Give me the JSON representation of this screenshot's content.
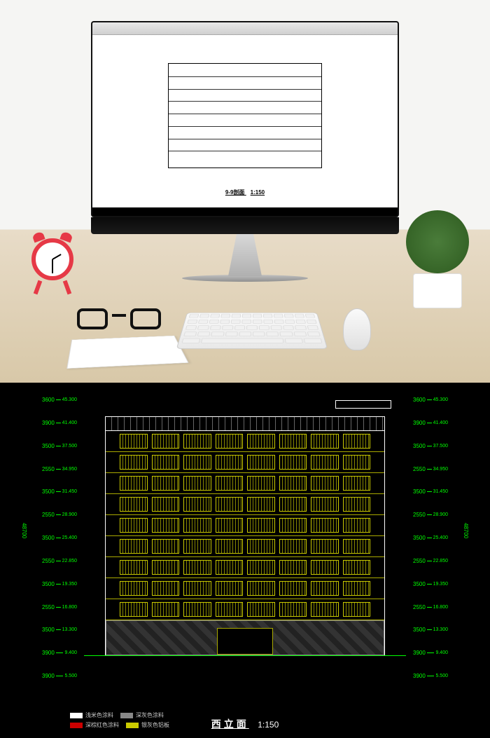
{
  "top_drawing": {
    "title": "9-9剖面",
    "scale": "1:150"
  },
  "elevation": {
    "title": "西立面",
    "scale": "1:150",
    "total_height": "48700",
    "floors": [
      {
        "height": "3600",
        "elevation": "45.300"
      },
      {
        "height": "3900",
        "elevation": "41.400"
      },
      {
        "height": "3500",
        "elevation": "37.500"
      },
      {
        "height": "2550",
        "elevation": "34.950"
      },
      {
        "height": "3500",
        "elevation": "31.450"
      },
      {
        "height": "2550",
        "elevation": "28.900"
      },
      {
        "height": "3500",
        "elevation": "25.400"
      },
      {
        "height": "2550",
        "elevation": "22.850"
      },
      {
        "height": "3500",
        "elevation": "19.350"
      },
      {
        "height": "2550",
        "elevation": "16.800"
      },
      {
        "height": "3500",
        "elevation": "13.300"
      },
      {
        "height": "3900",
        "elevation": "9.400"
      },
      {
        "height": "3900",
        "elevation": "5.500"
      }
    ],
    "right_floors": [
      {
        "height": "3600",
        "elevation": "45.300"
      },
      {
        "height": "3900",
        "elevation": "41.400"
      },
      {
        "height": "3500",
        "elevation": "37.500"
      },
      {
        "height": "2550",
        "elevation": "34.950"
      },
      {
        "height": "3500",
        "elevation": "31.450"
      },
      {
        "height": "2550",
        "elevation": "28.900"
      },
      {
        "height": "3500",
        "elevation": "25.400"
      },
      {
        "height": "2550",
        "elevation": "22.850"
      },
      {
        "height": "3500",
        "elevation": "19.350"
      },
      {
        "height": "2550",
        "elevation": "16.800"
      },
      {
        "height": "3500",
        "elevation": "13.300"
      },
      {
        "height": "3900",
        "elevation": "9.400"
      },
      {
        "height": "3900",
        "elevation": "5.500"
      }
    ],
    "legend": [
      {
        "color": "#fff",
        "label": "浅米色涂料"
      },
      {
        "color": "#888",
        "label": "深灰色涂料"
      },
      {
        "color": "#c00",
        "label": "深棕红色涂料"
      },
      {
        "color": "#cc0",
        "label": "银灰色铝板"
      }
    ]
  }
}
